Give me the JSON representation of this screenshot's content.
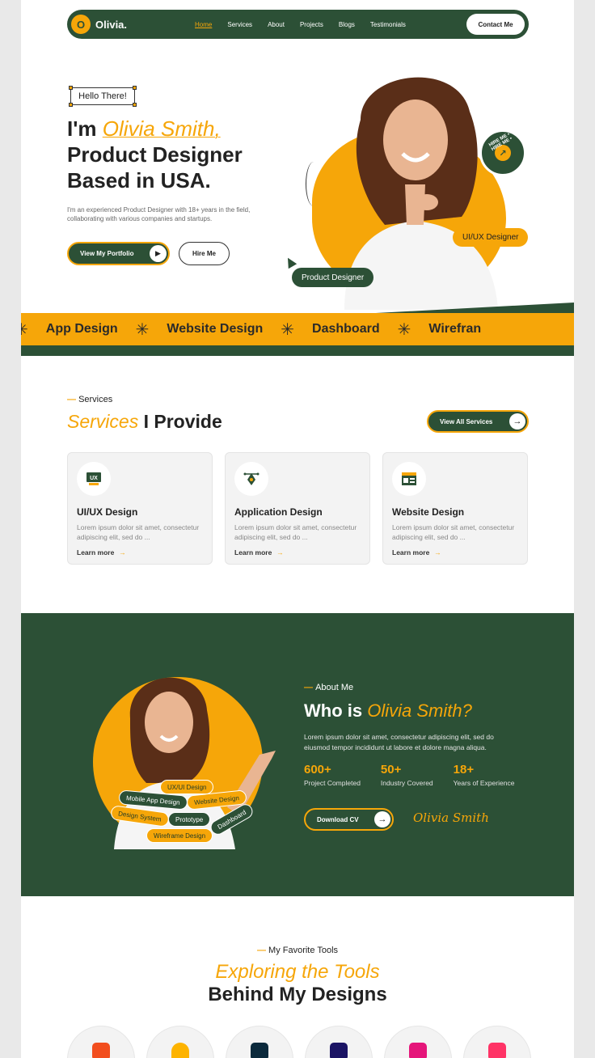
{
  "nav": {
    "logo_mark": "O",
    "logo_text": "Olivia.",
    "links": [
      "Home",
      "Services",
      "About",
      "Projects",
      "Blogs",
      "Testimonials"
    ],
    "active": "Home",
    "contact": "Contact Me"
  },
  "hero": {
    "greeting": "Hello There!",
    "title_prefix": "I'm ",
    "title_name": "Olivia Smith,",
    "title_line2": "Product Designer",
    "title_line3": "Based in USA.",
    "description": "I'm an experienced Product Designer with 18+ years in the field, collaborating with various companies and startups.",
    "portfolio_button": "View My Portfolio",
    "hire_button": "Hire Me",
    "badge_ring_text": "HIRE ME • HIRE ME •",
    "tag_uiux": "UI/UX Designer",
    "tag_product": "Product Designer"
  },
  "marquee": {
    "items": [
      "App Design",
      "Website Design",
      "Dashboard",
      "Wirefran"
    ]
  },
  "services": {
    "eyebrow": "Services",
    "title_highlight": "Services",
    "title_rest": " I Provide",
    "all_button": "View All Services",
    "cards": [
      {
        "icon": "ux-icon",
        "title": "UI/UX Design",
        "desc": "Lorem ipsum dolor sit amet, consectetur adipiscing elit, sed do ...",
        "link": "Learn more"
      },
      {
        "icon": "pen-tool-icon",
        "title": "Application Design",
        "desc": "Lorem ipsum dolor sit amet, consectetur adipiscing elit, sed do ...",
        "link": "Learn more"
      },
      {
        "icon": "browser-icon",
        "title": "Website Design",
        "desc": "Lorem ipsum dolor sit amet, consectetur adipiscing elit, sed do ...",
        "link": "Learn more"
      }
    ]
  },
  "about": {
    "eyebrow": "About Me",
    "title_prefix": "Who is ",
    "title_name": "Olivia Smith?",
    "description": "Lorem ipsum dolor sit amet, consectetur adipiscing elit, sed do eiusmod tempor incididunt ut labore et dolore magna aliqua.",
    "stats": [
      {
        "num": "600+",
        "label": "Project Completed"
      },
      {
        "num": "50+",
        "label": "Industry Covered"
      },
      {
        "num": "18+",
        "label": "Years of Experience"
      }
    ],
    "cv_button": "Download CV",
    "signature": "Olivia Smith",
    "pills": [
      "UX/UI Design",
      "Mobile App Design",
      "Website Design",
      "Design System",
      "Prototype",
      "Dashboard",
      "Wireframe Design"
    ]
  },
  "tools": {
    "eyebrow": "My Favorite Tools",
    "title_line1": "Exploring the Tools",
    "title_line2": "Behind My Designs",
    "items": [
      {
        "icon": "figma-icon",
        "color": "#f24e1e"
      },
      {
        "icon": "sketch-icon",
        "color": "#fdb300"
      },
      {
        "icon": "photoshop-icon",
        "color": "#0b2a3c"
      },
      {
        "icon": "after-effects-icon",
        "color": "#1b1464"
      },
      {
        "icon": "stackbit-icon",
        "color": "#e5157a"
      },
      {
        "icon": "invision-icon",
        "color": "#ff3366"
      }
    ]
  },
  "colors": {
    "accent": "#f6a609",
    "brand_green": "#2c5036"
  }
}
